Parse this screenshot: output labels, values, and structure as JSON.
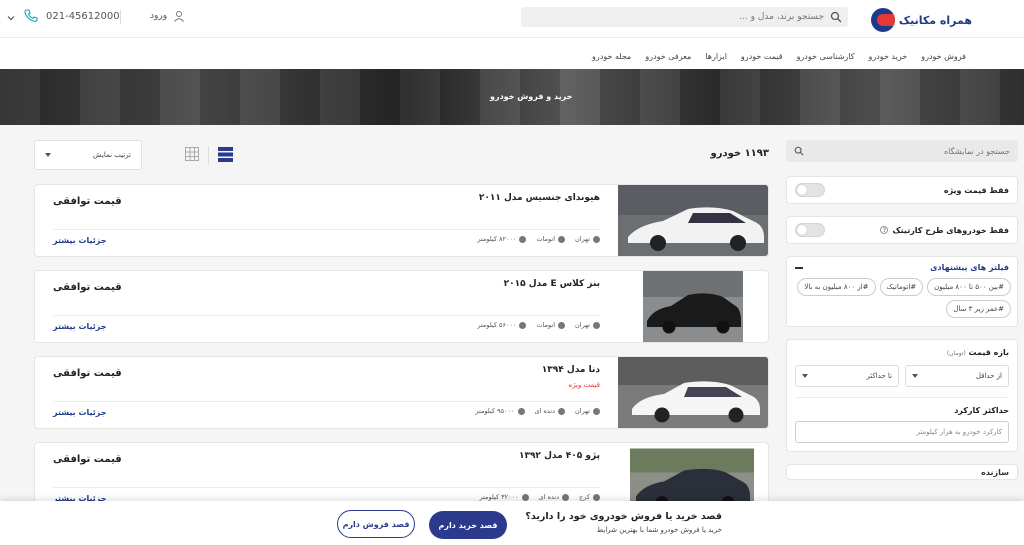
{
  "header": {
    "logo_text": "همراه مکانیک",
    "search_placeholder": "جستجو برند، مدل و ...",
    "login_label": "ورود",
    "phone": "021-45612000"
  },
  "nav": {
    "items": [
      "فروش خودرو",
      "خرید خودرو",
      "کارشناسی خودرو",
      "قیمت خودرو",
      "ابزارها",
      "معرفی خودرو",
      "مجله خودرو"
    ]
  },
  "banner": {
    "title": "خرید و فروش خودرو"
  },
  "toolbar": {
    "sort_label": "ترتیب نمایش",
    "count": "۱۱۹۳ خودرو"
  },
  "sidebar": {
    "search_placeholder": "جستجو در نمایشگاه",
    "special_price": "فقط قیمت ویژه",
    "carthink_cars": "فقط خودروهای طرح کارتینک",
    "suggested_title": "فیلتر های پیشنهادی",
    "tags": [
      "#بین ۵۰۰ تا ۸۰۰ میلیون",
      "#اتوماتیک",
      "#از ۸۰۰ میلیون به بالا",
      "#عمر زیر ۳ سال"
    ],
    "price_title": "بازه قیمت",
    "price_unit": "(تومان)",
    "min_label": "از حداقل",
    "max_label": "تا حداکثر",
    "km_title": "حداکثر کارکرد",
    "km_placeholder": "کارکرد خودرو به هزار کیلومتر",
    "collapsed_label": "سازنده"
  },
  "listings": [
    {
      "title": "هیوندای جنسیس مدل ۲۰۱۱",
      "special": "",
      "city": "تهران",
      "gearbox": "اتومات",
      "km": "۸۲۰۰۰ کیلومتر",
      "price": "قیمت توافقی",
      "more": "جزئیات بیشتر",
      "color": "#f2f2f2"
    },
    {
      "title": "بنز کلاس E مدل ۲۰۱۵",
      "special": "",
      "city": "تهران",
      "gearbox": "اتومات",
      "km": "۵۶۰۰۰ کیلومتر",
      "price": "قیمت توافقی",
      "more": "جزئیات بیشتر",
      "color": "#1a1a1a"
    },
    {
      "title": "دنا مدل ۱۳۹۴",
      "special": "قیمت ویژه",
      "city": "تهران",
      "gearbox": "دنده ای",
      "km": "۹۵۰۰۰ کیلومتر",
      "price": "قیمت توافقی",
      "more": "جزئیات بیشتر",
      "color": "#f5f5f5"
    },
    {
      "title": "پژو ۴۰۵ مدل ۱۳۹۲",
      "special": "",
      "city": "کرج",
      "gearbox": "دنده ای",
      "km": "۳۲۰۰۰ کیلومتر",
      "price": "قیمت توافقی",
      "more": "جزئیات بیشتر",
      "color": "#2a2f3a"
    }
  ],
  "cta": {
    "title": "قصد خرید یا فروش خودروی خود را دارید؟",
    "subtitle": "خرید یا فروش خودرو شما با بهترین شرایط",
    "buy": "قصد خرید دارم",
    "sell": "قصد فروش دارم"
  },
  "colors": {
    "brand": "#1e3a8a",
    "accent": "#e53935",
    "button": "#2b3a8c"
  }
}
